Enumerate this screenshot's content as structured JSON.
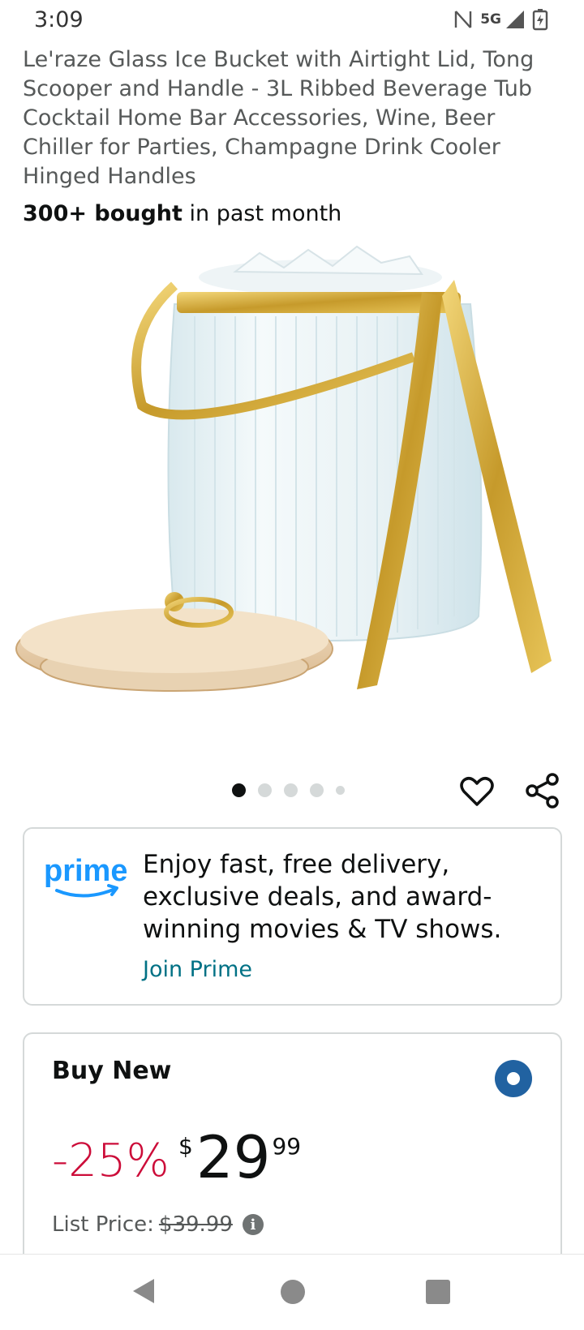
{
  "status_bar": {
    "time": "3:09",
    "network": "5G",
    "icons": [
      "nfc-icon",
      "signal-icon",
      "battery-charging-icon"
    ]
  },
  "product": {
    "title": "Le'raze Glass Ice Bucket with Airtight Lid, Tong Scooper and Handle - 3L Ribbed Beverage Tub Cocktail Home Bar Accessories, Wine, Beer Chiller for Parties, Champagne Drink Cooler Hinged Handles",
    "bought_bold": "300+ bought",
    "bought_rest": " in past month",
    "image_count": 5,
    "active_image": 1
  },
  "prime": {
    "logo_text": "prime",
    "message": "Enjoy fast, free delivery, exclusive deals, and award-winning movies & TV shows.",
    "link": "Join Prime",
    "logo_color": "#1a98ff"
  },
  "buy_box": {
    "title": "Buy New",
    "selected": true,
    "discount": "-25%",
    "currency": "$",
    "price_whole": "29",
    "price_fraction": "99",
    "list_price_label": "List Price:",
    "list_price": "$39.99"
  },
  "colors": {
    "discount": "#cc0c39",
    "link": "#007185",
    "radio": "#2162a1"
  }
}
